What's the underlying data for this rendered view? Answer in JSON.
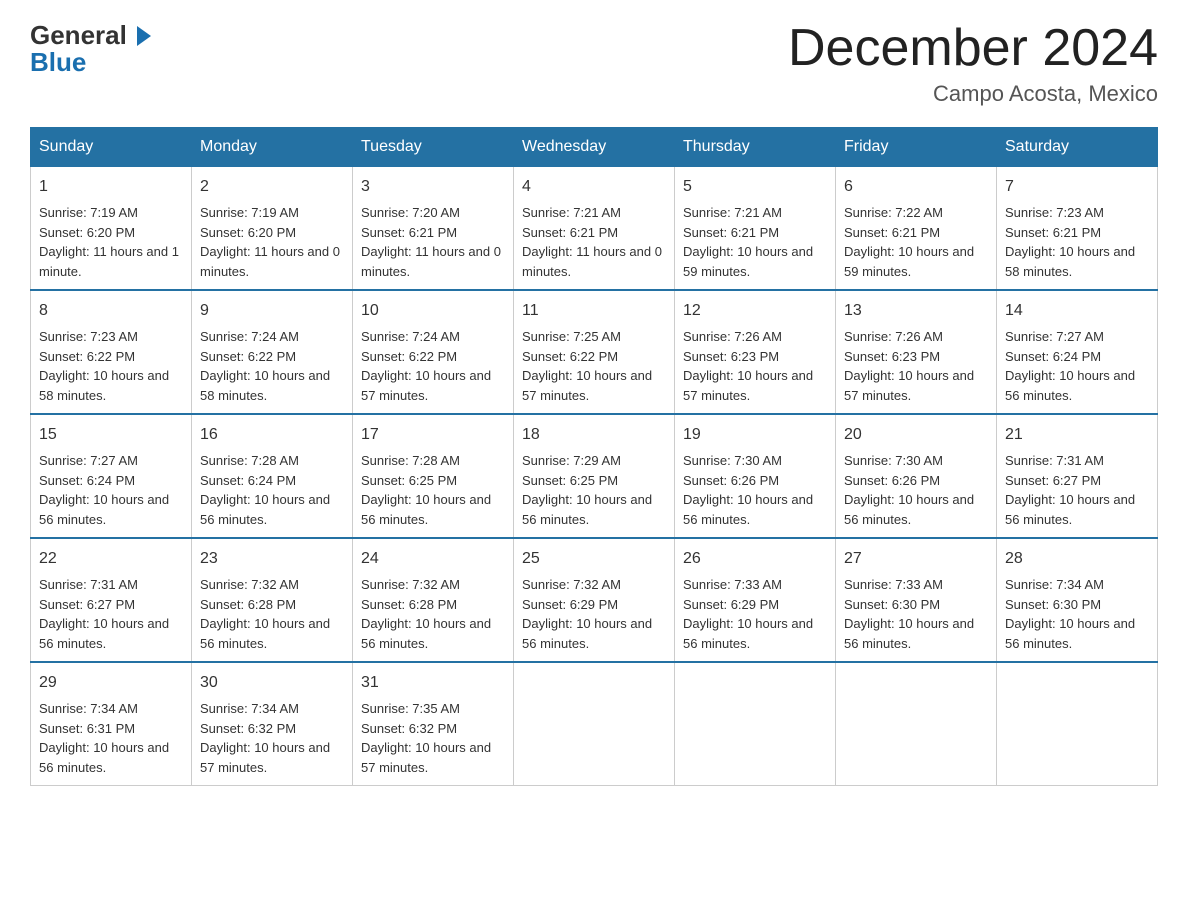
{
  "logo": {
    "general": "General",
    "blue": "Blue"
  },
  "title": "December 2024",
  "location": "Campo Acosta, Mexico",
  "days_of_week": [
    "Sunday",
    "Monday",
    "Tuesday",
    "Wednesday",
    "Thursday",
    "Friday",
    "Saturday"
  ],
  "weeks": [
    [
      {
        "day": "1",
        "sunrise": "7:19 AM",
        "sunset": "6:20 PM",
        "daylight": "11 hours and 1 minute."
      },
      {
        "day": "2",
        "sunrise": "7:19 AM",
        "sunset": "6:20 PM",
        "daylight": "11 hours and 0 minutes."
      },
      {
        "day": "3",
        "sunrise": "7:20 AM",
        "sunset": "6:21 PM",
        "daylight": "11 hours and 0 minutes."
      },
      {
        "day": "4",
        "sunrise": "7:21 AM",
        "sunset": "6:21 PM",
        "daylight": "11 hours and 0 minutes."
      },
      {
        "day": "5",
        "sunrise": "7:21 AM",
        "sunset": "6:21 PM",
        "daylight": "10 hours and 59 minutes."
      },
      {
        "day": "6",
        "sunrise": "7:22 AM",
        "sunset": "6:21 PM",
        "daylight": "10 hours and 59 minutes."
      },
      {
        "day": "7",
        "sunrise": "7:23 AM",
        "sunset": "6:21 PM",
        "daylight": "10 hours and 58 minutes."
      }
    ],
    [
      {
        "day": "8",
        "sunrise": "7:23 AM",
        "sunset": "6:22 PM",
        "daylight": "10 hours and 58 minutes."
      },
      {
        "day": "9",
        "sunrise": "7:24 AM",
        "sunset": "6:22 PM",
        "daylight": "10 hours and 58 minutes."
      },
      {
        "day": "10",
        "sunrise": "7:24 AM",
        "sunset": "6:22 PM",
        "daylight": "10 hours and 57 minutes."
      },
      {
        "day": "11",
        "sunrise": "7:25 AM",
        "sunset": "6:22 PM",
        "daylight": "10 hours and 57 minutes."
      },
      {
        "day": "12",
        "sunrise": "7:26 AM",
        "sunset": "6:23 PM",
        "daylight": "10 hours and 57 minutes."
      },
      {
        "day": "13",
        "sunrise": "7:26 AM",
        "sunset": "6:23 PM",
        "daylight": "10 hours and 57 minutes."
      },
      {
        "day": "14",
        "sunrise": "7:27 AM",
        "sunset": "6:24 PM",
        "daylight": "10 hours and 56 minutes."
      }
    ],
    [
      {
        "day": "15",
        "sunrise": "7:27 AM",
        "sunset": "6:24 PM",
        "daylight": "10 hours and 56 minutes."
      },
      {
        "day": "16",
        "sunrise": "7:28 AM",
        "sunset": "6:24 PM",
        "daylight": "10 hours and 56 minutes."
      },
      {
        "day": "17",
        "sunrise": "7:28 AM",
        "sunset": "6:25 PM",
        "daylight": "10 hours and 56 minutes."
      },
      {
        "day": "18",
        "sunrise": "7:29 AM",
        "sunset": "6:25 PM",
        "daylight": "10 hours and 56 minutes."
      },
      {
        "day": "19",
        "sunrise": "7:30 AM",
        "sunset": "6:26 PM",
        "daylight": "10 hours and 56 minutes."
      },
      {
        "day": "20",
        "sunrise": "7:30 AM",
        "sunset": "6:26 PM",
        "daylight": "10 hours and 56 minutes."
      },
      {
        "day": "21",
        "sunrise": "7:31 AM",
        "sunset": "6:27 PM",
        "daylight": "10 hours and 56 minutes."
      }
    ],
    [
      {
        "day": "22",
        "sunrise": "7:31 AM",
        "sunset": "6:27 PM",
        "daylight": "10 hours and 56 minutes."
      },
      {
        "day": "23",
        "sunrise": "7:32 AM",
        "sunset": "6:28 PM",
        "daylight": "10 hours and 56 minutes."
      },
      {
        "day": "24",
        "sunrise": "7:32 AM",
        "sunset": "6:28 PM",
        "daylight": "10 hours and 56 minutes."
      },
      {
        "day": "25",
        "sunrise": "7:32 AM",
        "sunset": "6:29 PM",
        "daylight": "10 hours and 56 minutes."
      },
      {
        "day": "26",
        "sunrise": "7:33 AM",
        "sunset": "6:29 PM",
        "daylight": "10 hours and 56 minutes."
      },
      {
        "day": "27",
        "sunrise": "7:33 AM",
        "sunset": "6:30 PM",
        "daylight": "10 hours and 56 minutes."
      },
      {
        "day": "28",
        "sunrise": "7:34 AM",
        "sunset": "6:30 PM",
        "daylight": "10 hours and 56 minutes."
      }
    ],
    [
      {
        "day": "29",
        "sunrise": "7:34 AM",
        "sunset": "6:31 PM",
        "daylight": "10 hours and 56 minutes."
      },
      {
        "day": "30",
        "sunrise": "7:34 AM",
        "sunset": "6:32 PM",
        "daylight": "10 hours and 57 minutes."
      },
      {
        "day": "31",
        "sunrise": "7:35 AM",
        "sunset": "6:32 PM",
        "daylight": "10 hours and 57 minutes."
      },
      null,
      null,
      null,
      null
    ]
  ]
}
